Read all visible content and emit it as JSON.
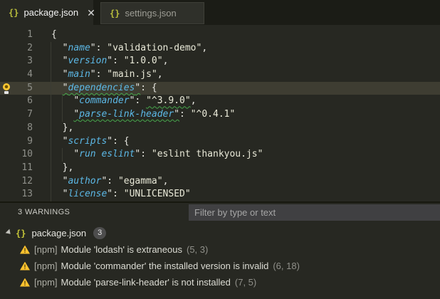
{
  "tabs": [
    {
      "label": "package.json",
      "active": true,
      "closable": true
    },
    {
      "label": "settings.json",
      "active": false
    }
  ],
  "editor": {
    "language": "json",
    "lines": [
      {
        "num": 1,
        "tokens": [
          [
            "{",
            "p"
          ]
        ]
      },
      {
        "num": 2,
        "tokens": [
          [
            "  ",
            "p"
          ],
          [
            "\"",
            "p"
          ],
          [
            "name",
            "k"
          ],
          [
            "\"",
            "p"
          ],
          [
            ": ",
            "p"
          ],
          [
            "\"validation-demo\"",
            "s"
          ],
          [
            ",",
            "p"
          ]
        ]
      },
      {
        "num": 3,
        "tokens": [
          [
            "  ",
            "p"
          ],
          [
            "\"",
            "p"
          ],
          [
            "version",
            "k"
          ],
          [
            "\"",
            "p"
          ],
          [
            ": ",
            "p"
          ],
          [
            "\"1.0.0\"",
            "s"
          ],
          [
            ",",
            "p"
          ]
        ]
      },
      {
        "num": 4,
        "tokens": [
          [
            "  ",
            "p"
          ],
          [
            "\"",
            "p"
          ],
          [
            "main",
            "k"
          ],
          [
            "\"",
            "p"
          ],
          [
            ": ",
            "p"
          ],
          [
            "\"main.js\"",
            "s"
          ],
          [
            ",",
            "p"
          ]
        ]
      },
      {
        "num": 5,
        "highlight": true,
        "lightbulb": true,
        "tokens": [
          [
            "  ",
            "p"
          ],
          [
            "\"",
            "p sq"
          ],
          [
            "dependencies",
            "k sq"
          ],
          [
            "\"",
            "p sq"
          ],
          [
            ": {",
            "p"
          ]
        ]
      },
      {
        "num": 6,
        "tokens": [
          [
            "    ",
            "p"
          ],
          [
            "\"",
            "p"
          ],
          [
            "commander",
            "k"
          ],
          [
            "\"",
            "p"
          ],
          [
            ": ",
            "p"
          ],
          [
            "\"^3.9.0\"",
            "s sq"
          ],
          [
            ",",
            "p"
          ]
        ]
      },
      {
        "num": 7,
        "tokens": [
          [
            "    ",
            "p"
          ],
          [
            "\"",
            "p sq"
          ],
          [
            "parse-link-header",
            "k sq"
          ],
          [
            "\"",
            "p sq"
          ],
          [
            ": ",
            "p"
          ],
          [
            "\"^0.4.1\"",
            "s"
          ]
        ]
      },
      {
        "num": 8,
        "tokens": [
          [
            "  },",
            "p"
          ]
        ]
      },
      {
        "num": 9,
        "tokens": [
          [
            "  ",
            "p"
          ],
          [
            "\"",
            "p"
          ],
          [
            "scripts",
            "k"
          ],
          [
            "\"",
            "p"
          ],
          [
            ": {",
            "p"
          ]
        ]
      },
      {
        "num": 10,
        "tokens": [
          [
            "    ",
            "p"
          ],
          [
            "\"",
            "p"
          ],
          [
            "run eslint",
            "k"
          ],
          [
            "\"",
            "p"
          ],
          [
            ": ",
            "p"
          ],
          [
            "\"eslint thankyou.js\"",
            "s"
          ]
        ]
      },
      {
        "num": 11,
        "tokens": [
          [
            "  },",
            "p"
          ]
        ]
      },
      {
        "num": 12,
        "tokens": [
          [
            "  ",
            "p"
          ],
          [
            "\"",
            "p"
          ],
          [
            "author",
            "k"
          ],
          [
            "\"",
            "p"
          ],
          [
            ": ",
            "p"
          ],
          [
            "\"egamma\"",
            "s"
          ],
          [
            ",",
            "p"
          ]
        ]
      },
      {
        "num": 13,
        "tokens": [
          [
            "  ",
            "p"
          ],
          [
            "\"",
            "p"
          ],
          [
            "license",
            "k"
          ],
          [
            "\"",
            "p"
          ],
          [
            ": ",
            "p"
          ],
          [
            "\"UNLICENSED\"",
            "s"
          ]
        ]
      }
    ]
  },
  "panel": {
    "title": "3 WARNINGS",
    "filter_placeholder": "Filter by type or text",
    "filter_value": "",
    "file": {
      "label": "package.json",
      "badge": "3",
      "expanded": true
    },
    "warnings": [
      {
        "source": "[npm]",
        "message": "Module 'lodash' is extraneous",
        "location": "(5, 3)"
      },
      {
        "source": "[npm]",
        "message": "Module 'commander' the installed version is invalid",
        "location": "(6, 18)"
      },
      {
        "source": "[npm]",
        "message": "Module 'parse-link-header' is not installed",
        "location": "(7, 5)"
      }
    ]
  },
  "colors": {
    "editor_bg": "#272822",
    "tabbar_bg": "#1b1c16",
    "line_highlight": "#3e3d32",
    "key_color": "#5cb8e6",
    "string_color": "#e9e9d8",
    "squiggle_color": "#46a84b",
    "line_number_color": "#8f908a",
    "json_icon_color": "#b9be3c",
    "warning_icon_color": "#fcc22e",
    "lightbulb_color": "#ffc832",
    "filter_bg": "#404042",
    "badge_bg": "#4d4d4d"
  }
}
